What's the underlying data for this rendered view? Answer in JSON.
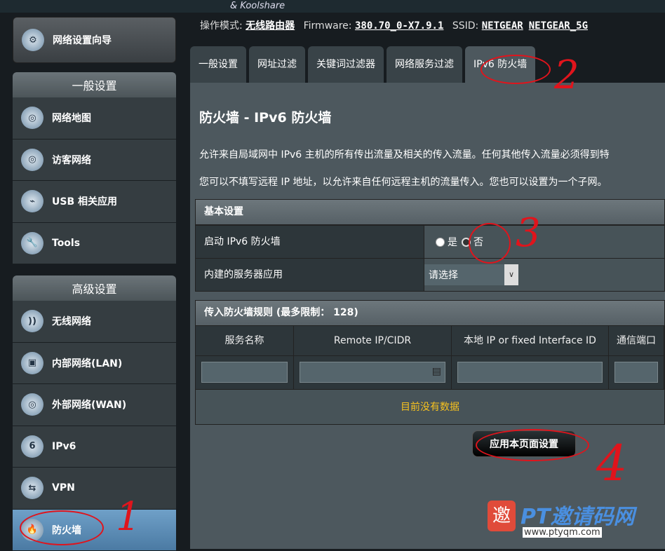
{
  "banner": "& Koolshare",
  "sidebar": {
    "wizard": "网络设置向导",
    "general_header": "一般设置",
    "general": [
      "网络地图",
      "访客网络",
      "USB 相关应用",
      "Tools"
    ],
    "advanced_header": "高级设置",
    "advanced": [
      "无线网络",
      "内部网络(LAN)",
      "外部网络(WAN)",
      "IPv6",
      "VPN",
      "防火墙"
    ]
  },
  "info": {
    "mode_label": "操作模式:",
    "mode": "无线路由器",
    "fw_label": "Firmware:",
    "fw": "380.70_0-X7.9.1",
    "ssid_label": "SSID:",
    "ssid1": "NETGEAR",
    "ssid2": "NETGEAR_5G"
  },
  "tabs": [
    "一般设置",
    "网址过滤",
    "关键词过滤器",
    "网络服务过滤",
    "IPv6 防火墙"
  ],
  "main": {
    "title": "防火墙 - IPv6 防火墙",
    "desc1": "允许来自局域网中 IPv6 主机的所有传出流量及相关的传入流量。任何其他传入流量必须得到特",
    "desc2": "您可以不填写远程 IP 地址，以允许来自任何远程主机的流量传入。您也可以设置为一个子网。",
    "basic": {
      "header": "基本设置",
      "enable_label": "启动 IPv6 防火墙",
      "yes": "是",
      "no": "否",
      "server_label": "内建的服务器应用",
      "select": "请选择"
    },
    "rules": {
      "header": "传入防火墙规则 (最多限制： 128)",
      "columns": [
        "服务名称",
        "Remote IP/CIDR",
        "本地 IP or fixed Interface ID",
        "通信端口"
      ],
      "empty": "目前没有数据"
    },
    "apply": "应用本页面设置"
  },
  "annotations": [
    "1",
    "2",
    "3",
    "4"
  ],
  "watermark": {
    "logo": "邀",
    "text": "PT邀请码网",
    "url": "www.ptyqm.com"
  }
}
